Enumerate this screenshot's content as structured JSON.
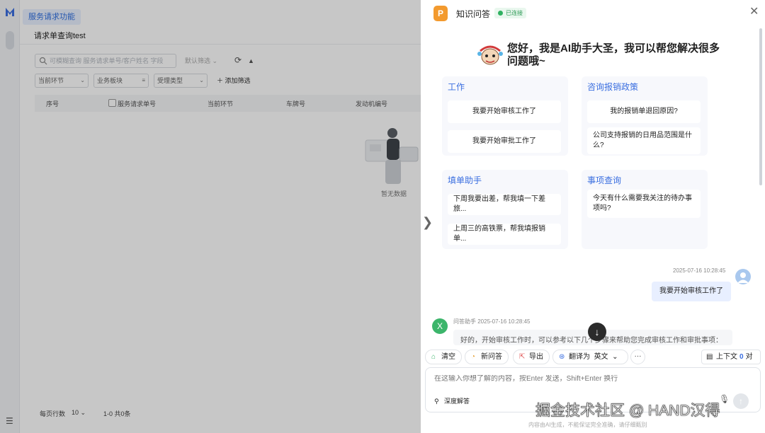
{
  "app": {
    "tab_label": "服务请求功能",
    "page_title": "请求单查询test",
    "search_placeholder": "可模糊查询 服务请求单号/客户姓名 字段",
    "default_filter": "默认筛选",
    "filters": [
      "当前环节",
      "业务板块",
      "受理类型"
    ],
    "add_filter": "添加筛选",
    "columns": [
      "序号",
      "服务请求单号",
      "当前环节",
      "车牌号",
      "发动机编号"
    ],
    "empty_text": "暂无数据",
    "pager_label": "每页行数",
    "pager_size": "10",
    "pager_info": "1-0  共0条"
  },
  "drawer": {
    "title": "知识问答",
    "logo_letter": "P",
    "status": "已连接",
    "greeting": "您好，我是AI助手大圣，我可以帮您解决很多问题哦~",
    "categories": [
      {
        "title": "工作",
        "questions": [
          "我要开始审核工作了",
          "我要开始审批工作了"
        ]
      },
      {
        "title": "咨询报销政策",
        "questions": [
          "我的报销单退回原因?",
          "公司支持报销的日用品范围是什么?"
        ]
      },
      {
        "title": "填单助手",
        "questions": [
          "下周我要出差，帮我填一下差旅...",
          "上周三的高铁票，帮我填报销单..."
        ]
      },
      {
        "title": "事项查询",
        "questions": [
          "今天有什么需要我关注的待办事项吗?"
        ]
      }
    ],
    "messages": {
      "user_time": "2025-07-16 10:28:45",
      "user_text": "我要开始审核工作了",
      "bot_avatar": "X",
      "bot_meta": "问答助手 2025-07-16 10:28:45",
      "bot_text": "好的，开始审核工作时，可以参考以下几个步骤来帮助您完成审核工作和审批事项："
    },
    "toolbar": {
      "clear": "清空",
      "new_qa": "新问答",
      "export": "导出",
      "translate": "翻译为",
      "lang": "英文",
      "more": "···",
      "context": "上下文",
      "context_count": "0",
      "context_suffix": "对"
    },
    "input_placeholder": "在这输入你想了解的内容，按Enter 发送，Shift+Enter 换行",
    "deep_answer": "深度解答",
    "disclaimer": "内容由AI生成，不能保证完全准确，请仔细甄别"
  },
  "watermark": "掘金技术社区 @ HAND汉得",
  "colors": {
    "accent": "#3b6fe0",
    "status_green": "#2fb160",
    "logo_orange": "#f39a2e"
  }
}
